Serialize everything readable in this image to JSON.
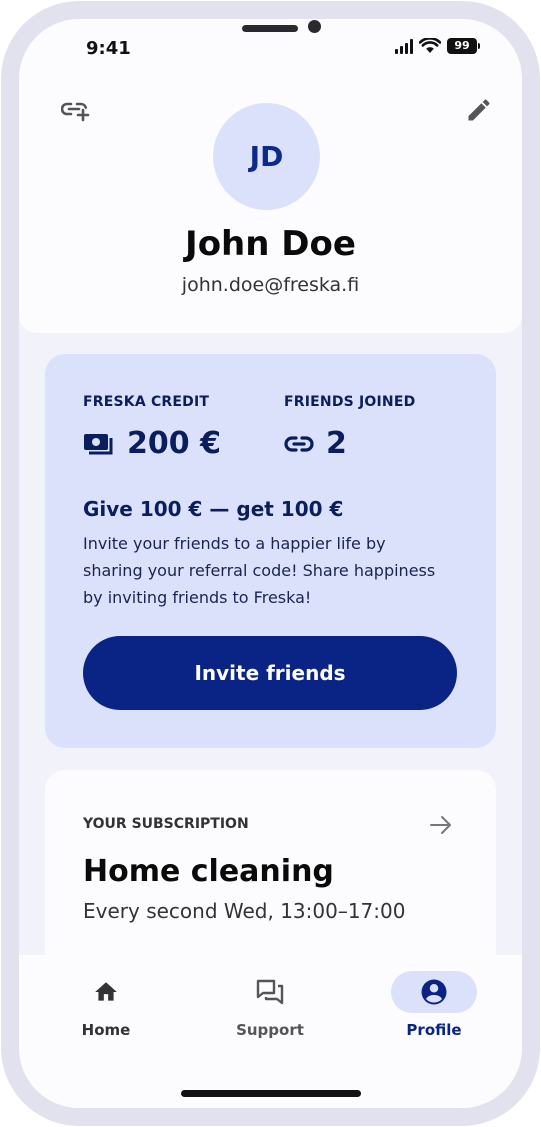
{
  "status_bar": {
    "time": "9:41",
    "battery": "99"
  },
  "profile": {
    "initials": "JD",
    "name": "John Doe",
    "email": "john.doe@freska.fi"
  },
  "referral": {
    "credit_label": "FRESKA CREDIT",
    "credit_value": "200 €",
    "friends_label": "FRIENDS JOINED",
    "friends_value": "2",
    "promo_title": "Give 100 € — get 100 €",
    "promo_text": "Invite your friends to a happier life by sharing your referral code! Share happiness by inviting friends to Freska!",
    "invite_button": "Invite friends"
  },
  "subscription": {
    "label": "YOUR SUBSCRIPTION",
    "title": "Home cleaning",
    "schedule": "Every second Wed, 13:00–17:00"
  },
  "nav": {
    "items": [
      {
        "label": "Home",
        "icon": "home-icon",
        "active": false
      },
      {
        "label": "Support",
        "icon": "chat-icon",
        "active": false
      },
      {
        "label": "Profile",
        "icon": "account-circle-icon",
        "active": true
      }
    ]
  },
  "colors": {
    "brand_dark": "#0a2485",
    "card_blue": "#dbe1fb",
    "background": "#f2f2fa"
  }
}
